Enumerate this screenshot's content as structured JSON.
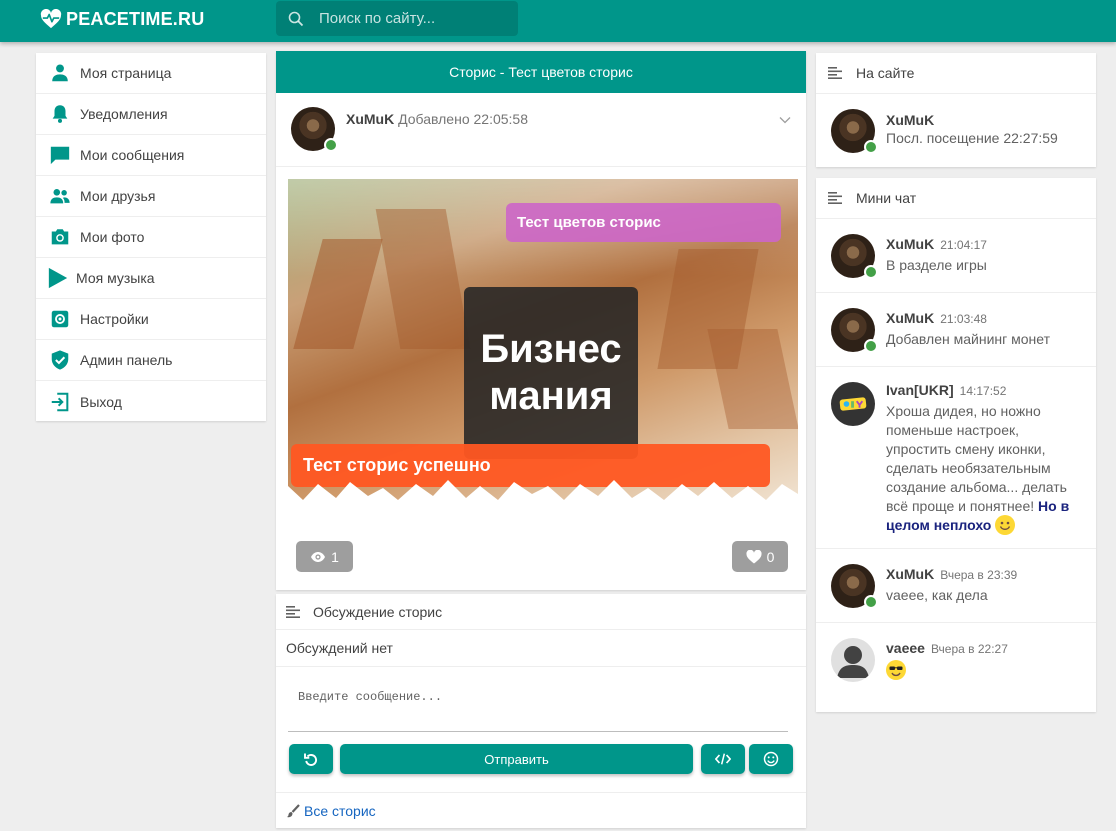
{
  "header": {
    "logo_text": "PEACETIME.RU",
    "search_placeholder": "Поиск по сайту...",
    "brand_color": "#00968a"
  },
  "sidebar": {
    "items": [
      {
        "label": "Моя страница",
        "icon": "person-icon"
      },
      {
        "label": "Уведомления",
        "icon": "bell-icon"
      },
      {
        "label": "Мои сообщения",
        "icon": "chat-bubble-icon"
      },
      {
        "label": "Мои друзья",
        "icon": "people-icon"
      },
      {
        "label": "Мои фото",
        "icon": "camera-icon"
      },
      {
        "label": "Моя музыка",
        "icon": "play-icon"
      },
      {
        "label": "Настройки",
        "icon": "settings-icon"
      },
      {
        "label": "Админ панель",
        "icon": "shield-check-icon"
      },
      {
        "label": "Выход",
        "icon": "exit-icon"
      }
    ]
  },
  "story": {
    "title": "Сторис - Тест цветов сторис",
    "author": "XuMuK",
    "added_label": "Добавлено 22:05:58",
    "poster_line1": "Бизнес",
    "poster_line2": "мания",
    "caption_top": "Тест цветов сторис",
    "caption_bottom": "Тест сторис успешно",
    "views": "1",
    "likes": "0"
  },
  "discussion": {
    "title": "Обсуждение сторис",
    "empty_text": "Обсуждений нет",
    "input_placeholder": "Введите сообщение...",
    "send_label": "Отправить",
    "all_stories_label": "Все сторис"
  },
  "online": {
    "title": "На сайте",
    "user": "XuMuK",
    "last_visit": "Посл. посещение 22:27:59"
  },
  "mini_chat": {
    "title": "Мини чат",
    "messages": [
      {
        "name": "XuMuK",
        "time": "21:04:17",
        "text": "В разделе игры"
      },
      {
        "name": "XuMuK",
        "time": "21:03:48",
        "text": "Добавлен майнинг монет"
      },
      {
        "name": "Ivan[UKR]",
        "time": "14:17:52",
        "text": "Хроша дидея, но ножно поменьше настроек, упростить смену иконки, сделать необязательным создание альбома... делать всё проще и понятнее!",
        "highlight": "Но в целом неплохо"
      },
      {
        "name": "XuMuK",
        "time": "Вчера в 23:39",
        "text": "vaeee, как дела"
      },
      {
        "name": "vaeee",
        "time": "Вчера в 22:27",
        "text": ""
      }
    ]
  }
}
